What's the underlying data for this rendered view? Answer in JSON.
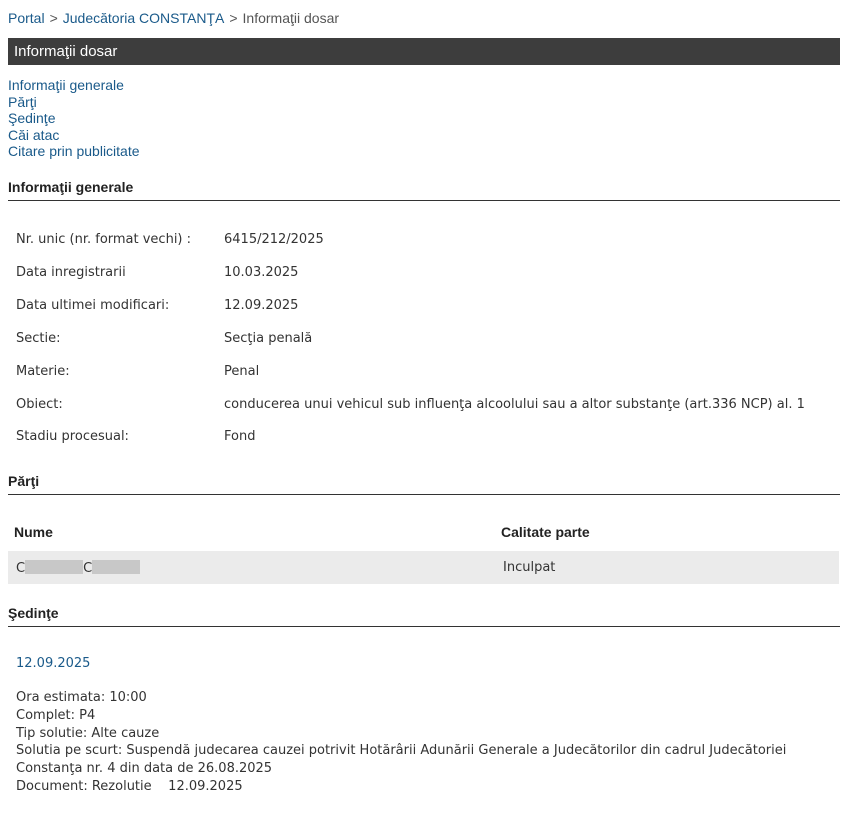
{
  "breadcrumb": {
    "portal": "Portal",
    "court": "Judecătoria CONSTANŢA",
    "current": "Informaţii dosar",
    "separator": ">"
  },
  "page_title": "Informaţii dosar",
  "toc": [
    "Informaţii generale",
    "Părţi",
    "Şedinţe",
    "Căi atac",
    "Citare prin publicitate"
  ],
  "general": {
    "heading": "Informaţii generale",
    "rows": [
      {
        "label": "Nr. unic (nr. format vechi) :",
        "value": "6415/212/2025"
      },
      {
        "label": "Data inregistrarii",
        "value": "10.03.2025"
      },
      {
        "label": "Data ultimei modificari:",
        "value": "12.09.2025"
      },
      {
        "label": "Sectie:",
        "value": "Secţia penală"
      },
      {
        "label": "Materie:",
        "value": "Penal"
      },
      {
        "label": "Obiect:",
        "value": "conducerea unui vehicul sub influenţa alcoolului sau a altor substanţe (art.336 NCP) al. 1"
      },
      {
        "label": "Stadiu procesual:",
        "value": "Fond"
      }
    ]
  },
  "parti": {
    "heading": "Părţi",
    "columns": [
      "Nume",
      "Calitate parte"
    ],
    "rows": [
      {
        "name_initial_1": "C",
        "name_initial_2": "C",
        "role": "Inculpat"
      }
    ]
  },
  "sedinte": {
    "heading": "Şedinţe",
    "date_link": "12.09.2025",
    "lines": [
      "Ora estimata: 10:00",
      "Complet: P4",
      "Tip solutie: Alte cauze",
      "Solutia pe scurt: Suspendă judecarea cauzei potrivit Hotărârii Adunării Generale a Judecătorilor din cadrul Judecătoriei",
      "Constanţa nr. 4 din data de 26.08.2025",
      "Document: Rezolutie    12.09.2025"
    ]
  }
}
